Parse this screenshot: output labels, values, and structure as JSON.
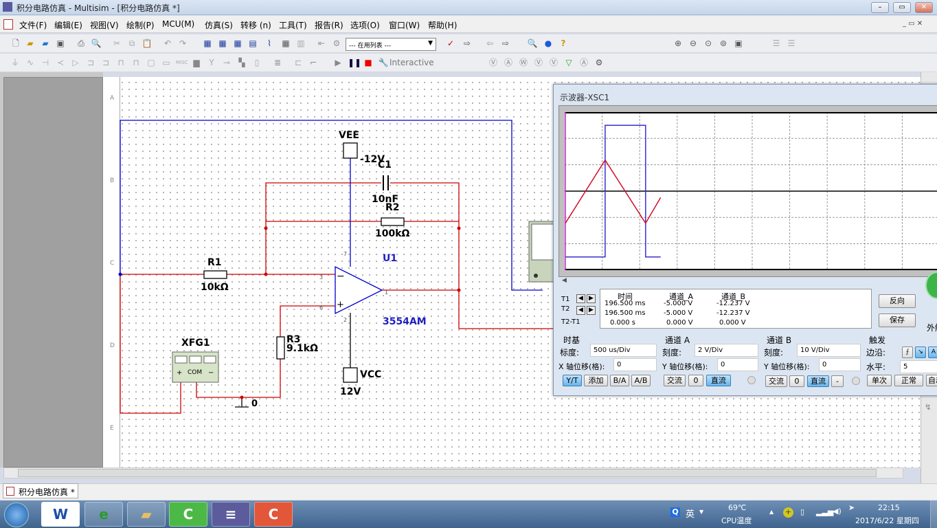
{
  "window": {
    "title": "积分电路仿真 - Multisim - [积分电路仿真 *]",
    "controls": [
      "–",
      "▭",
      "✕"
    ]
  },
  "menu": [
    "文件(F)",
    "编辑(E)",
    "视图(V)",
    "绘制(P)",
    "MCU(M)",
    "仿真(S)",
    "转移 (n)",
    "工具(T)",
    "报告(R)",
    "选项(O)",
    "窗口(W)",
    "帮助(H)"
  ],
  "toolbar": {
    "in_use_list": "--- 在用列表 ---",
    "interactive_label": "Interactive"
  },
  "ruler": [
    "A",
    "B",
    "C",
    "D",
    "E"
  ],
  "schematic": {
    "vee": "VEE",
    "vee_value": "-12V",
    "c1": "C1",
    "c1_value": "10nF",
    "r2": "R2",
    "r2_value": "100kΩ",
    "u1": "U1",
    "u1_model": "3554AM",
    "r1": "R1",
    "r1_value": "10kΩ",
    "r3": "R3",
    "r3_value": "9.1kΩ",
    "xfg": "XFG1",
    "com": "COM",
    "vcc": "VCC",
    "vcc_value": "12V",
    "ground": "0",
    "pins": {
      "minus": "3",
      "plus": "6",
      "out": "1",
      "v_top": "7",
      "v_bot": "2"
    },
    "colors": {
      "wire_red": "#cc0000",
      "wire_blue": "#0000cc",
      "label": "#2020c0"
    }
  },
  "scope": {
    "title": "示波器-XSC1",
    "readout": {
      "headers": [
        "时间",
        "通道_A",
        "通道_B"
      ],
      "rows": [
        {
          "label": "T1",
          "time": "196.500 ms",
          "a": "-5.000 V",
          "b": "-12.237 V"
        },
        {
          "label": "T2",
          "time": "196.500 ms",
          "a": "-5.000 V",
          "b": "-12.237 V"
        },
        {
          "label": "T2-T1",
          "time": "0.000 s",
          "a": "0.000 V",
          "b": "0.000 V"
        }
      ]
    },
    "reverse": "反向",
    "save": "保存",
    "ext_trigger": "外触",
    "timebase": {
      "title": "时基",
      "scale_label": "标度:",
      "scale": "500 us/Div",
      "xpos_label": "X 轴位移(格):",
      "xpos": "0",
      "modes": [
        "Y/T",
        "添加",
        "B/A",
        "A/B"
      ],
      "active_mode": "Y/T"
    },
    "channel_a": {
      "title": "通道 A",
      "scale_label": "刻度:",
      "scale": "2  V/Div",
      "ypos_label": "Y 轴位移(格):",
      "ypos": "0",
      "coupling": [
        "交流",
        "0",
        "直流"
      ],
      "active": "直流"
    },
    "channel_b": {
      "title": "通道 B",
      "scale_label": "刻度:",
      "scale": "10  V/Div",
      "ypos_label": "Y 轴位移(格):",
      "ypos": "0",
      "coupling": [
        "交流",
        "0",
        "直流",
        "-"
      ],
      "active": "直流"
    },
    "trigger": {
      "title": "触发",
      "edge_label": "边沿:",
      "level_label": "水平:",
      "level": "5",
      "modes": [
        "单次",
        "正常",
        "自动"
      ]
    },
    "traces": {
      "time_unit": "ms",
      "channel_a": {
        "color": "#3a2fd0",
        "t": [
          0,
          0.53,
          0.53,
          1.07,
          1.07,
          1.27
        ],
        "v": [
          -5,
          -5,
          5,
          5,
          -5,
          -5
        ]
      },
      "channel_b": {
        "color": "#d0102a",
        "t": [
          0,
          0.53,
          1.07,
          1.27
        ],
        "v": [
          -12.2,
          11.8,
          -12.2,
          -2.4
        ]
      }
    }
  },
  "tab": "积分电路仿真 *",
  "taskbar": {
    "ime": "英",
    "cpu_temp": "69℃",
    "cpu_label": "CPU温度",
    "time": "22:15",
    "date": "2017/6/22 星期四"
  }
}
